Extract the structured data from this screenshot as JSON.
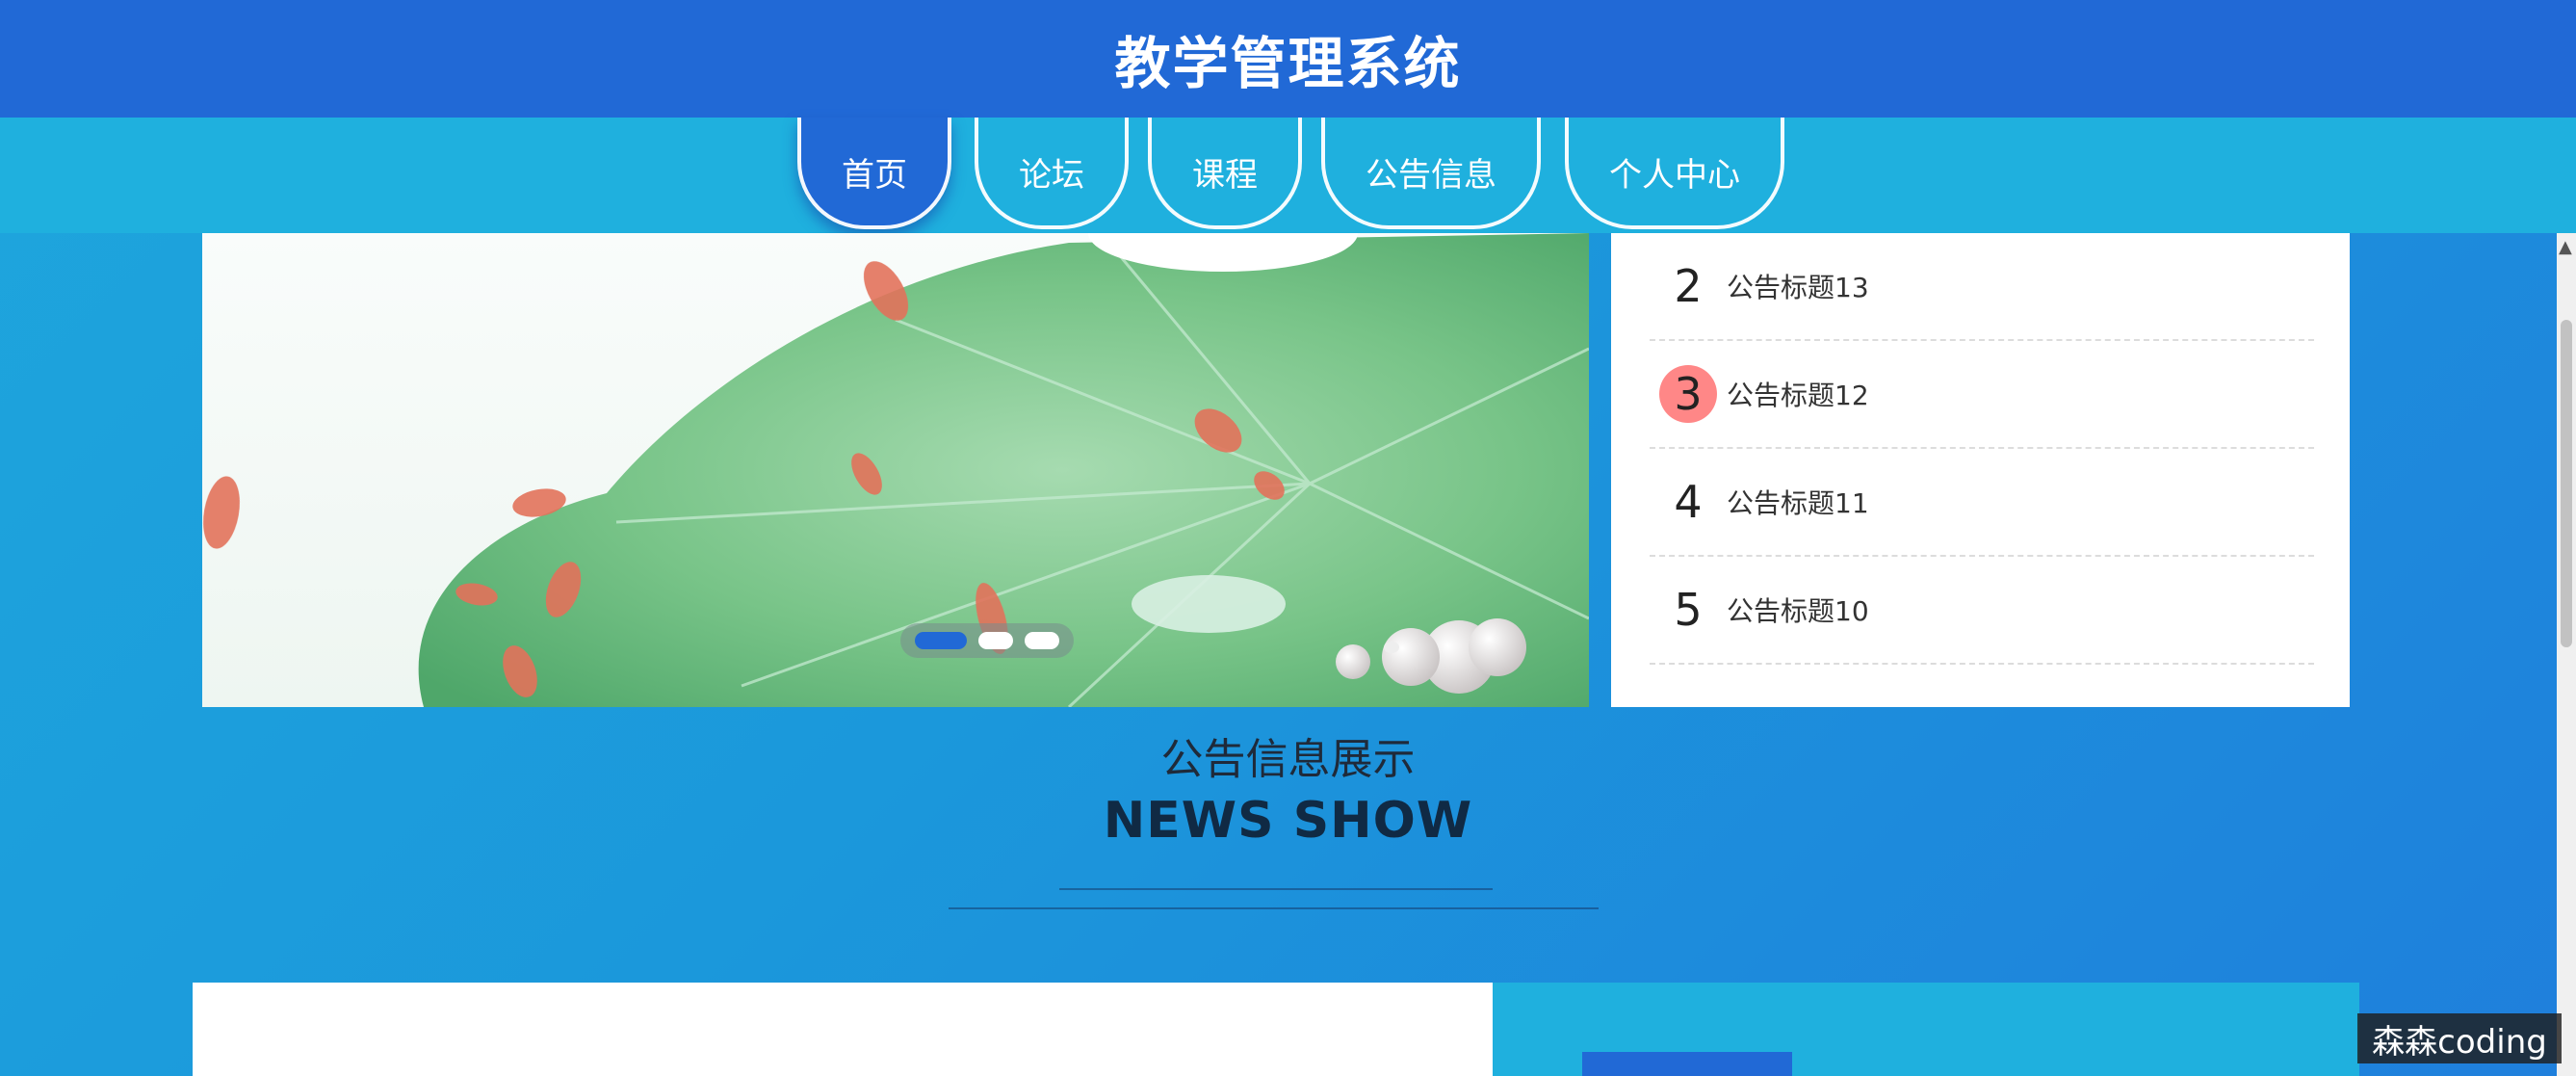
{
  "header": {
    "title": "教学管理系统"
  },
  "nav": {
    "items": [
      "首页",
      "论坛",
      "课程",
      "公告信息",
      "个人中心"
    ],
    "active_index": 0
  },
  "banner": {
    "slide_count": 3,
    "active_slide": 0
  },
  "notices": [
    {
      "num": "2",
      "title": "公告标题13"
    },
    {
      "num": "3",
      "title": "公告标题12"
    },
    {
      "num": "4",
      "title": "公告标题11"
    },
    {
      "num": "5",
      "title": "公告标题10"
    }
  ],
  "section": {
    "title_cn": "公告信息展示",
    "title_en": "NEWS SHOW"
  },
  "watermark": "森森coding",
  "colors": {
    "header": "#2169d6",
    "nav": "#1fb0de",
    "accent": "#2169d6"
  }
}
